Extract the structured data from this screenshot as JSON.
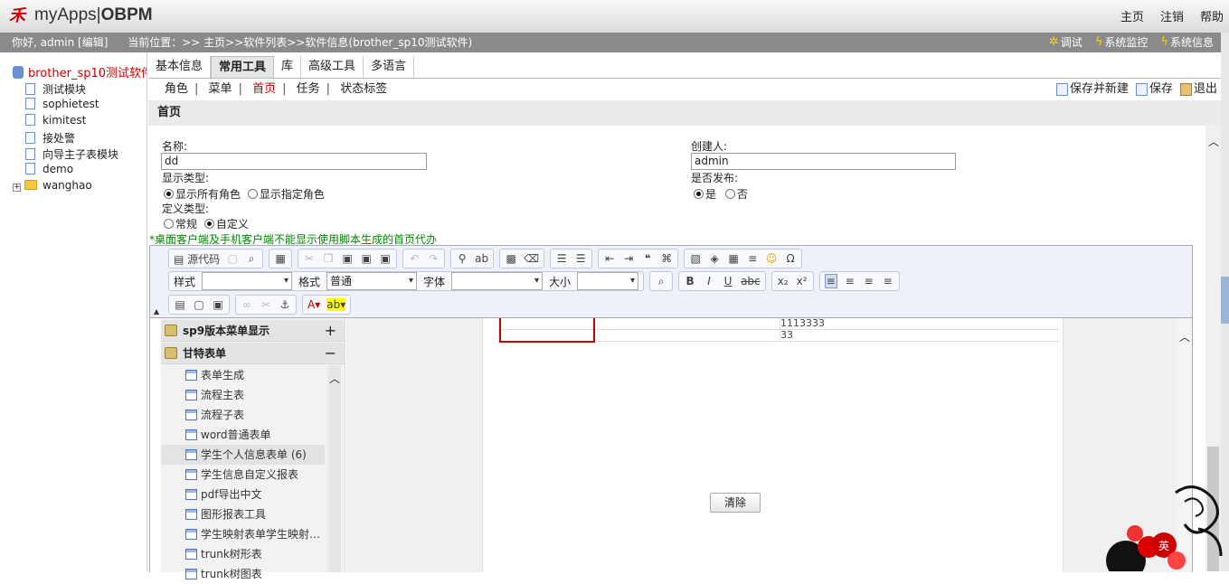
{
  "app": {
    "logo_mark": "禾",
    "name_a": "myApps",
    "name_b": "OBPM"
  },
  "topnav": [
    "主页",
    "注销",
    "帮助"
  ],
  "statusbar": {
    "greeting": "你好, admin [编辑]",
    "location": "当前位置：>> 主页>>软件列表>>软件信息(brother_sp10测试软件)",
    "tools": [
      "调试",
      "系统监控",
      "系统信息"
    ]
  },
  "tree": {
    "root": "brother_sp10测试软件",
    "items": [
      "测试模块",
      "sophietest",
      "kimitest",
      "接处警",
      "向导主子表模块",
      "demo",
      "wanghao"
    ]
  },
  "tabs": [
    "基本信息",
    "常用工具",
    "库",
    "高级工具",
    "多语言"
  ],
  "active_tab": "常用工具",
  "subtabs": [
    "角色",
    "菜单",
    "首页",
    "任务",
    "状态标签"
  ],
  "active_subtab": "首页",
  "actions": [
    "保存并新建",
    "保存",
    "退出"
  ],
  "section_title": "首页",
  "form": {
    "name_label": "名称:",
    "name_value": "dd",
    "creator_label": "创建人:",
    "creator_value": "admin",
    "display_type_label": "显示类型:",
    "display_options": [
      "显示所有角色",
      "显示指定角色"
    ],
    "display_selected": 0,
    "publish_label": "是否发布:",
    "publish_options": [
      "是",
      "否"
    ],
    "publish_selected": 0,
    "define_type_label": "定义类型:",
    "define_options": [
      "常规",
      "自定义"
    ],
    "define_selected": 1,
    "hint": "*桌面客户端及手机客户端不能显示使用脚本生成的首页代办"
  },
  "editor": {
    "source_label": "源代码",
    "style_label": "样式",
    "format_label": "格式",
    "format_value": "普通",
    "font_label": "字体",
    "size_label": "大小"
  },
  "left_panel": {
    "groups": [
      "sp9版本菜单显示",
      "甘特表单"
    ],
    "items": [
      "表单生成",
      "流程主表",
      "流程子表",
      "word普通表单",
      "学生个人信息表单 (6)",
      "学生信息自定义报表",
      "pdf导出中文",
      "图形报表工具",
      "学生映射表单学生映射…",
      "trunk树形表",
      "trunk树图表"
    ]
  },
  "content": {
    "cells": [
      "1113333",
      "33"
    ],
    "clear_button": "清除"
  },
  "deco_char": "英"
}
